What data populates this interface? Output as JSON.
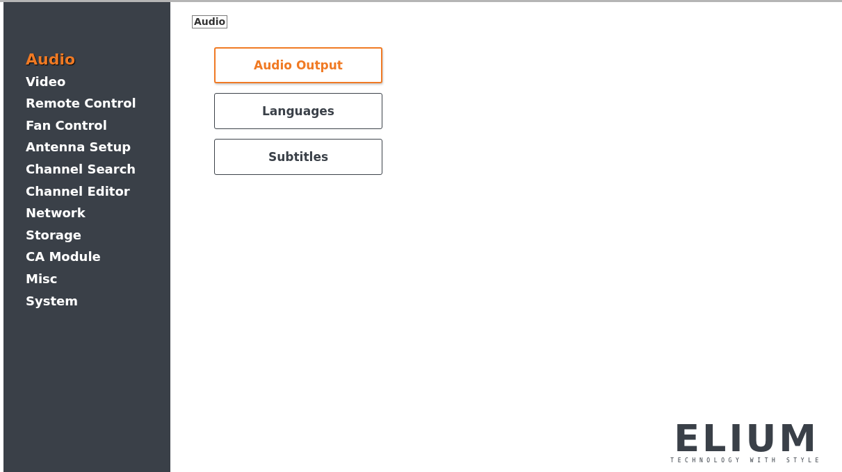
{
  "sidebar": {
    "items": [
      {
        "label": "Audio",
        "selected": true
      },
      {
        "label": "Video",
        "selected": false
      },
      {
        "label": "Remote Control",
        "selected": false
      },
      {
        "label": "Fan Control",
        "selected": false
      },
      {
        "label": "Antenna Setup",
        "selected": false
      },
      {
        "label": "Channel Search",
        "selected": false
      },
      {
        "label": "Channel Editor",
        "selected": false
      },
      {
        "label": "Network",
        "selected": false
      },
      {
        "label": "Storage",
        "selected": false
      },
      {
        "label": "CA Module",
        "selected": false
      },
      {
        "label": "Misc",
        "selected": false
      },
      {
        "label": "System",
        "selected": false
      }
    ]
  },
  "breadcrumb": "Audio",
  "menu": [
    {
      "label": "Audio Output",
      "selected": true
    },
    {
      "label": "Languages",
      "selected": false
    },
    {
      "label": "Subtitles",
      "selected": false
    }
  ],
  "logo": {
    "name": "ELIUM",
    "tagline": "TECHNOLOGY WITH STYLE"
  }
}
